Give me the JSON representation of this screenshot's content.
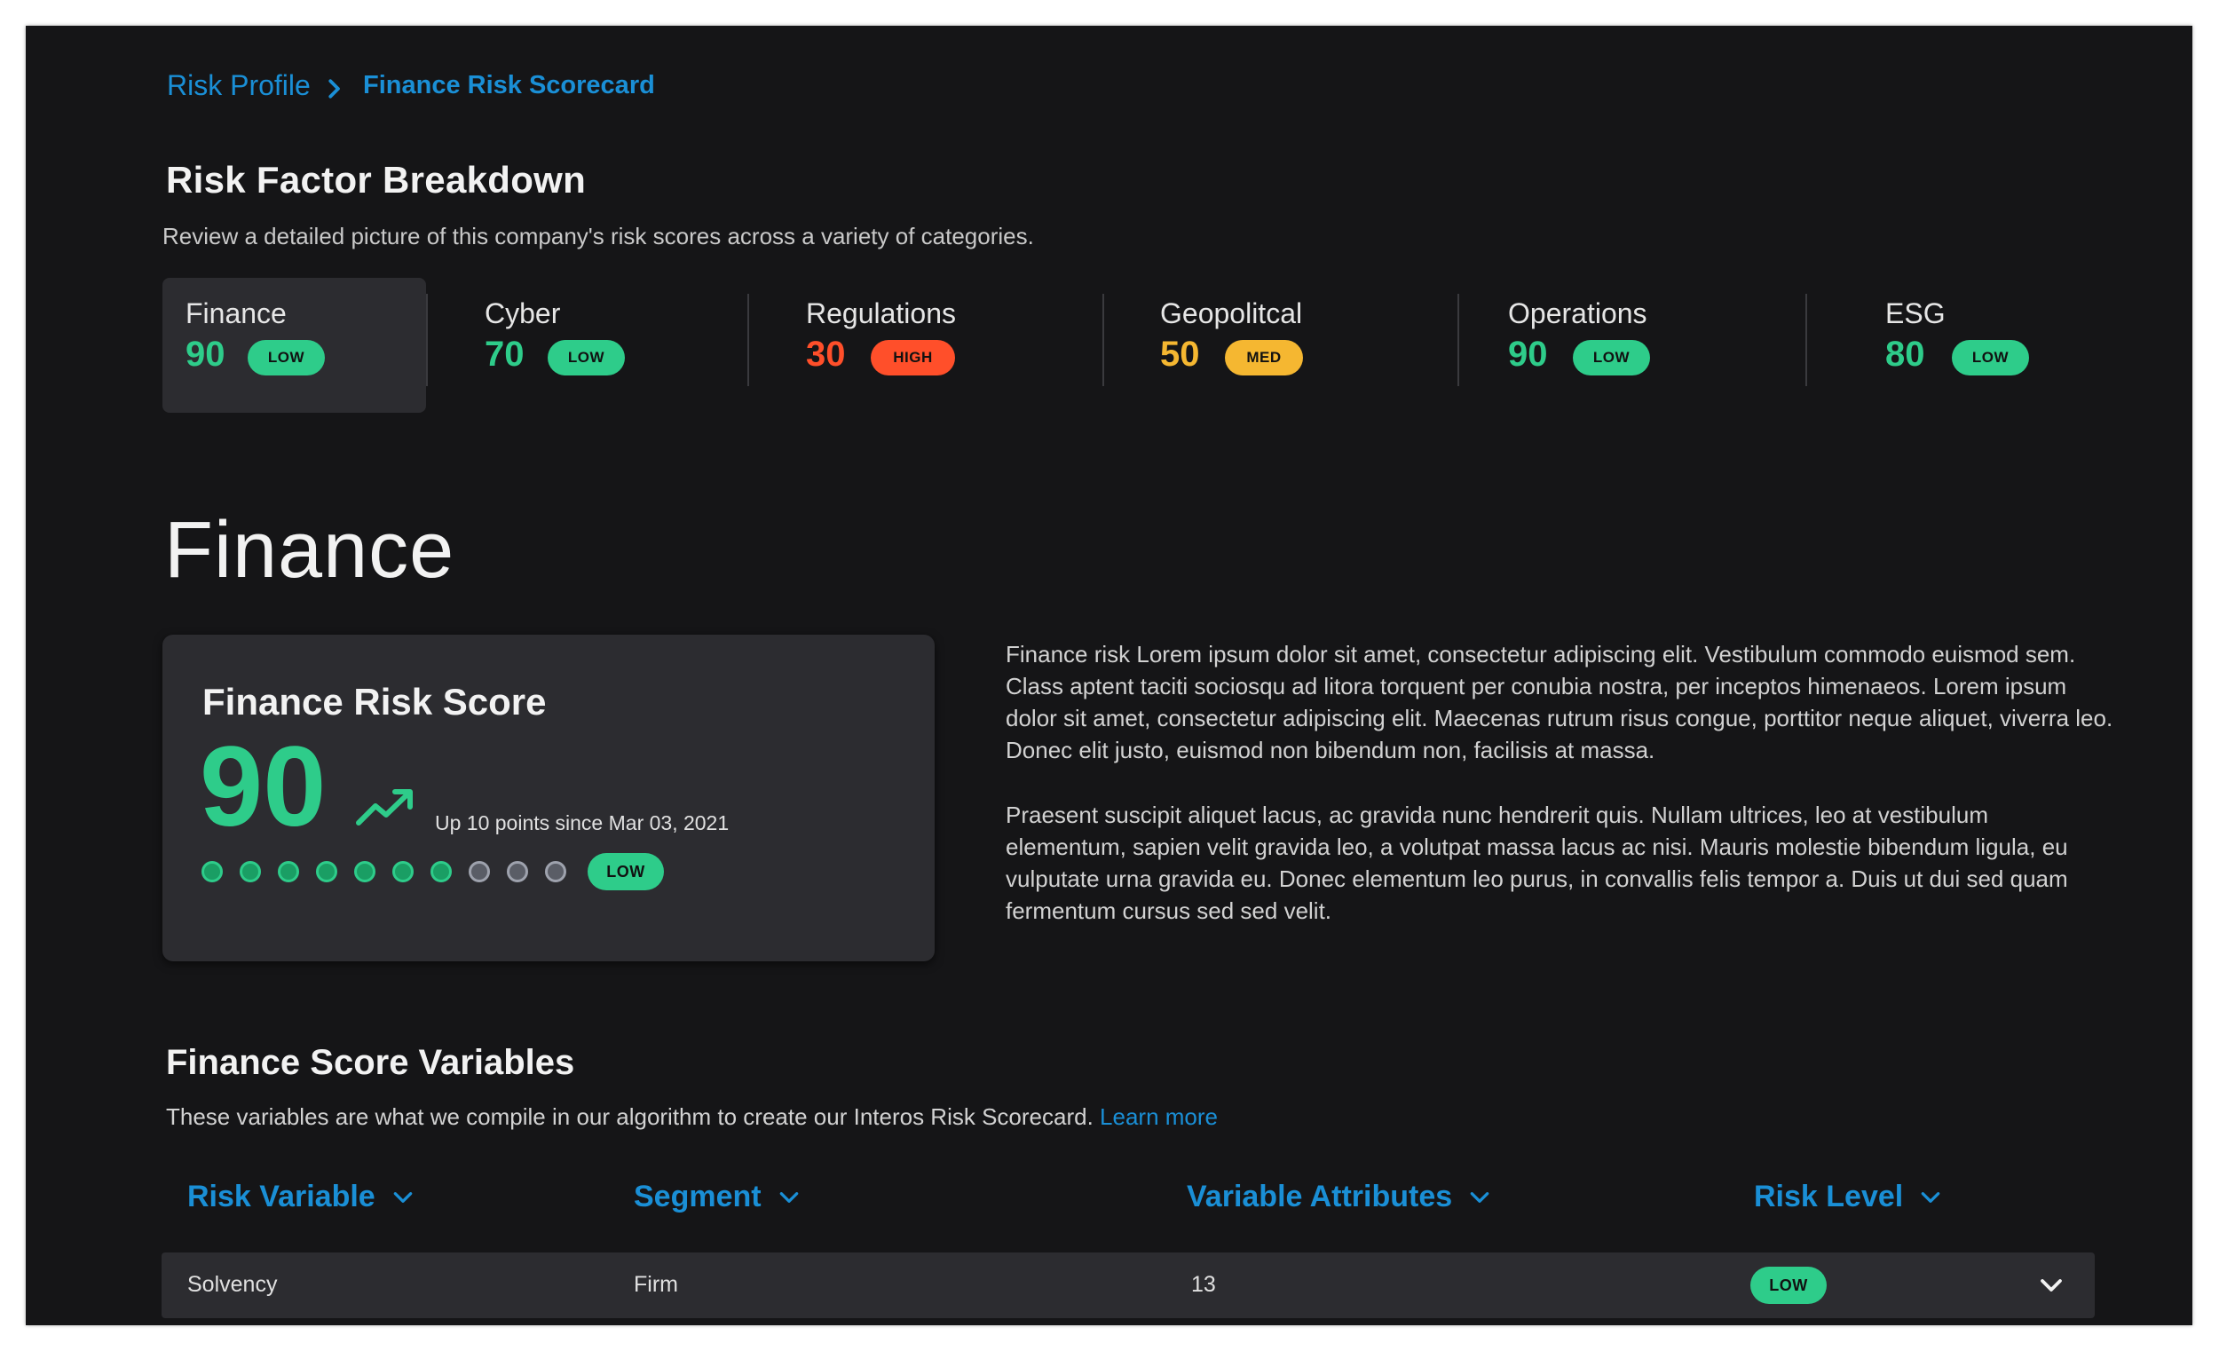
{
  "breadcrumb": {
    "parent": "Risk Profile",
    "current": "Finance Risk Scorecard"
  },
  "overview": {
    "title": "Risk Factor Breakdown",
    "description": "Review a detailed picture of this company's risk scores across a variety of categories."
  },
  "categories": [
    {
      "name": "Finance",
      "score": "90",
      "level": "LOW",
      "color": "#2ecc8a",
      "active": true
    },
    {
      "name": "Cyber",
      "score": "70",
      "level": "LOW",
      "color": "#2ecc8a",
      "active": false
    },
    {
      "name": "Regulations",
      "score": "30",
      "level": "HIGH",
      "color": "#ff4f2a",
      "active": false
    },
    {
      "name": "Geopolitcal",
      "score": "50",
      "level": "MED",
      "color": "#f5b731",
      "active": false
    },
    {
      "name": "Operations",
      "score": "90",
      "level": "LOW",
      "color": "#2ecc8a",
      "active": false
    },
    {
      "name": "ESG",
      "score": "80",
      "level": "LOW",
      "color": "#2ecc8a",
      "active": false
    }
  ],
  "detail": {
    "heading": "Finance",
    "card": {
      "title": "Finance Risk Score",
      "score": "90",
      "trend_icon": "trending-up-icon",
      "change_note": "Up 10 points since Mar 03, 2021",
      "level": "LOW",
      "filled_dots": 7,
      "total_dots": 10
    },
    "paragraphs": [
      "Finance risk Lorem ipsum dolor sit amet, consectetur adipiscing elit. Vestibulum commodo euismod sem. Class aptent taciti sociosqu ad litora torquent per conubia nostra, per inceptos himenaeos. Lorem ipsum dolor sit amet, consectetur adipiscing elit. Maecenas rutrum risus congue, porttitor neque aliquet, viverra leo. Donec elit justo, euismod non bibendum non, facilisis at massa.",
      "Praesent suscipit aliquet lacus, ac gravida nunc hendrerit quis. Nullam ultrices, leo at vestibulum elementum, sapien velit gravida leo, a volutpat massa lacus ac nisi. Mauris molestie bibendum ligula, eu vulputate urna gravida eu. Donec elementum leo purus, in convallis felis tempor a. Duis ut dui sed quam fermentum cursus sed sed velit."
    ]
  },
  "variables": {
    "title": "Finance Score Variables",
    "description": "These variables are what we compile in our algorithm to create our Interos Risk Scorecard.",
    "learn_more": "Learn more",
    "columns": [
      "Risk Variable",
      "Segment",
      "Variable Attributes",
      "Risk Level"
    ],
    "rows": [
      {
        "variable": "Solvency",
        "segment": "Firm",
        "attributes": "13",
        "level": "LOW"
      }
    ]
  },
  "colors": {
    "background": "#151517",
    "panel": "#2c2c30",
    "accent": "#1a8fd6",
    "low": "#2ecc8a",
    "med": "#f5b731",
    "high": "#ff4f2a"
  }
}
